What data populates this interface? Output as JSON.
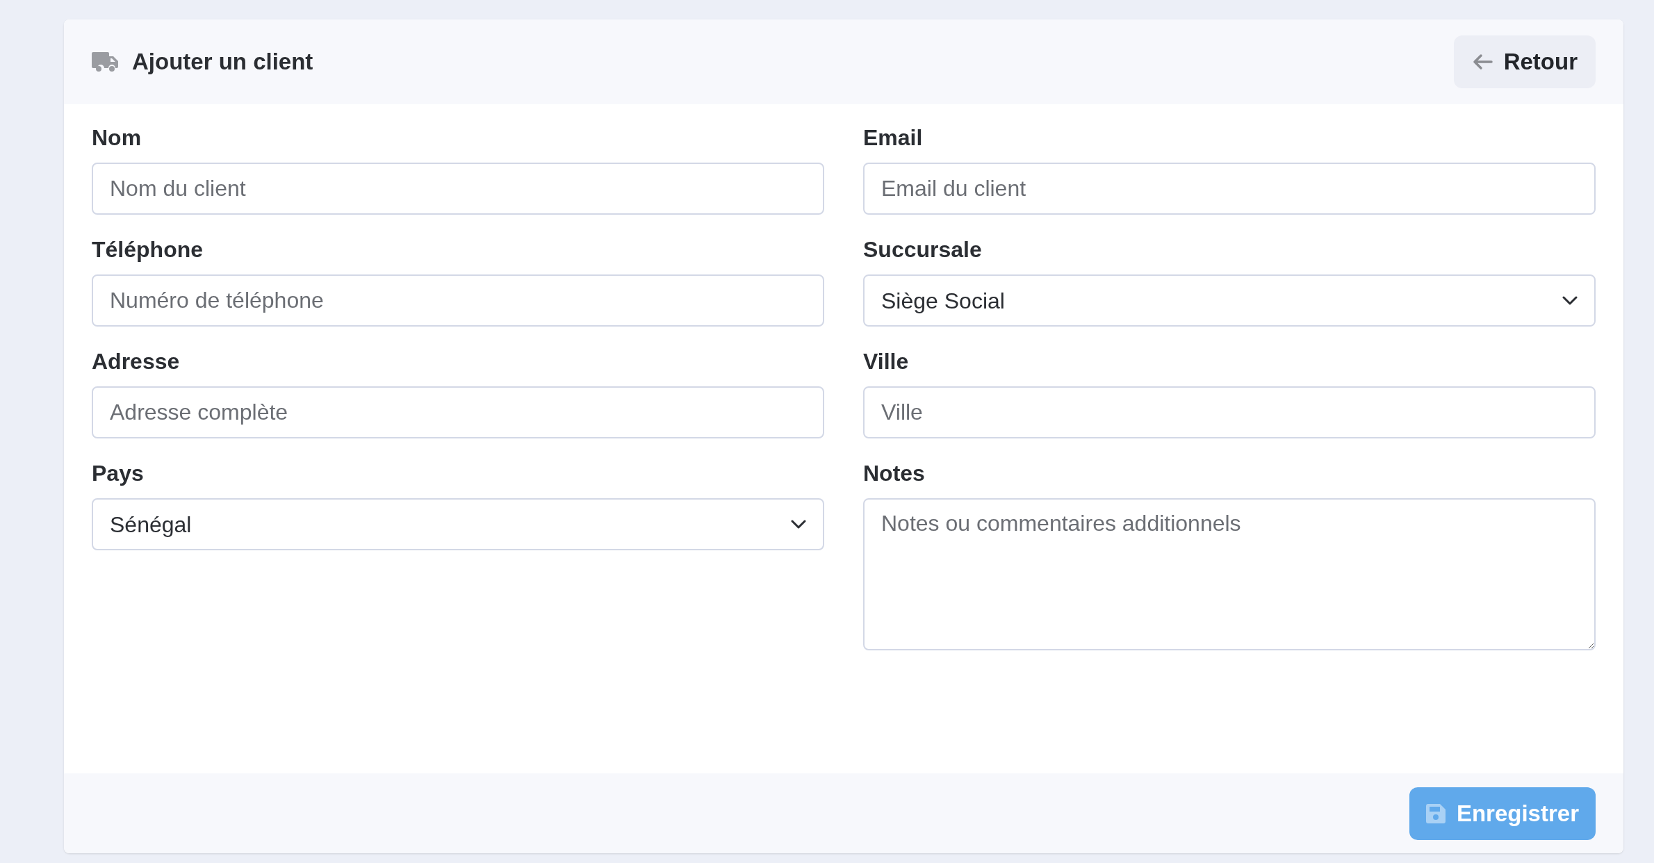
{
  "header": {
    "title": "Ajouter un client",
    "back_button": "Retour"
  },
  "fields": [
    {
      "kind": "input",
      "label": "Nom",
      "placeholder": "Nom du client"
    },
    {
      "kind": "input",
      "label": "Email",
      "placeholder": "Email du client"
    },
    {
      "kind": "input",
      "label": "Téléphone",
      "placeholder": "Numéro de téléphone"
    },
    {
      "kind": "select",
      "label": "Succursale",
      "value": "Siège Social"
    },
    {
      "kind": "input",
      "label": "Adresse",
      "placeholder": "Adresse complète"
    },
    {
      "kind": "input",
      "label": "Ville",
      "placeholder": "Ville"
    },
    {
      "kind": "select",
      "label": "Pays",
      "value": "Sénégal"
    },
    {
      "kind": "textarea",
      "label": "Notes",
      "placeholder": "Notes ou commentaires additionnels"
    }
  ],
  "save_button": "Enregistrer"
}
